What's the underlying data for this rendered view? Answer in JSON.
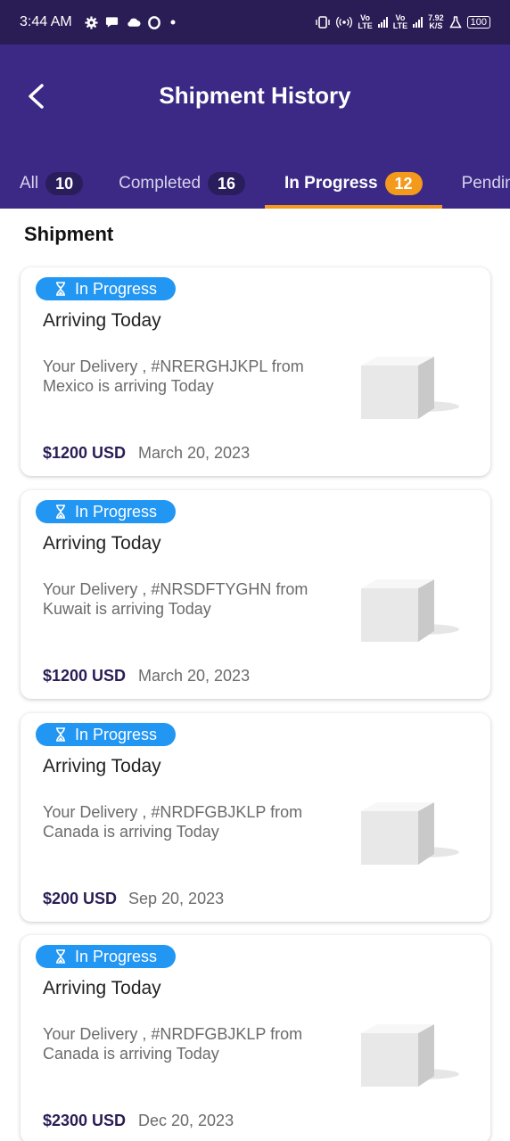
{
  "status_bar": {
    "time": "3:44 AM",
    "net_speed": "7.92\nK/S",
    "lte_1": "Vo\nLTE",
    "lte_2": "Vo\nLTE",
    "battery": "100"
  },
  "header": {
    "title": "Shipment History"
  },
  "tabs": [
    {
      "label": "All",
      "count": "10"
    },
    {
      "label": "Completed",
      "count": "16"
    },
    {
      "label": "In Progress",
      "count": "12"
    },
    {
      "label": "Pending",
      "count": ""
    }
  ],
  "section_title": "Shipment",
  "shipments": [
    {
      "status": "In Progress",
      "title": "Arriving Today",
      "description": "Your Delivery , #NRERGHJKPL from Mexico is arriving Today",
      "price": "$1200 USD",
      "date": "March 20, 2023"
    },
    {
      "status": "In Progress",
      "title": "Arriving Today",
      "description": "Your Delivery , #NRSDFTYGHN from Kuwait is arriving Today",
      "price": "$1200 USD",
      "date": "March 20, 2023"
    },
    {
      "status": "In Progress",
      "title": "Arriving Today",
      "description": "Your Delivery , #NRDFGBJKLP from Canada is arriving Today",
      "price": "$200 USD",
      "date": "Sep 20, 2023"
    },
    {
      "status": "In Progress",
      "title": "Arriving Today",
      "description": "Your Delivery , #NRDFGBJKLP from Canada is arriving Today",
      "price": "$2300 USD",
      "date": "Dec 20, 2023"
    }
  ],
  "colors": {
    "app_bar": "#3b2985",
    "status_bar": "#2a1d55",
    "accent": "#f39a1d",
    "pill": "#2196f3"
  }
}
